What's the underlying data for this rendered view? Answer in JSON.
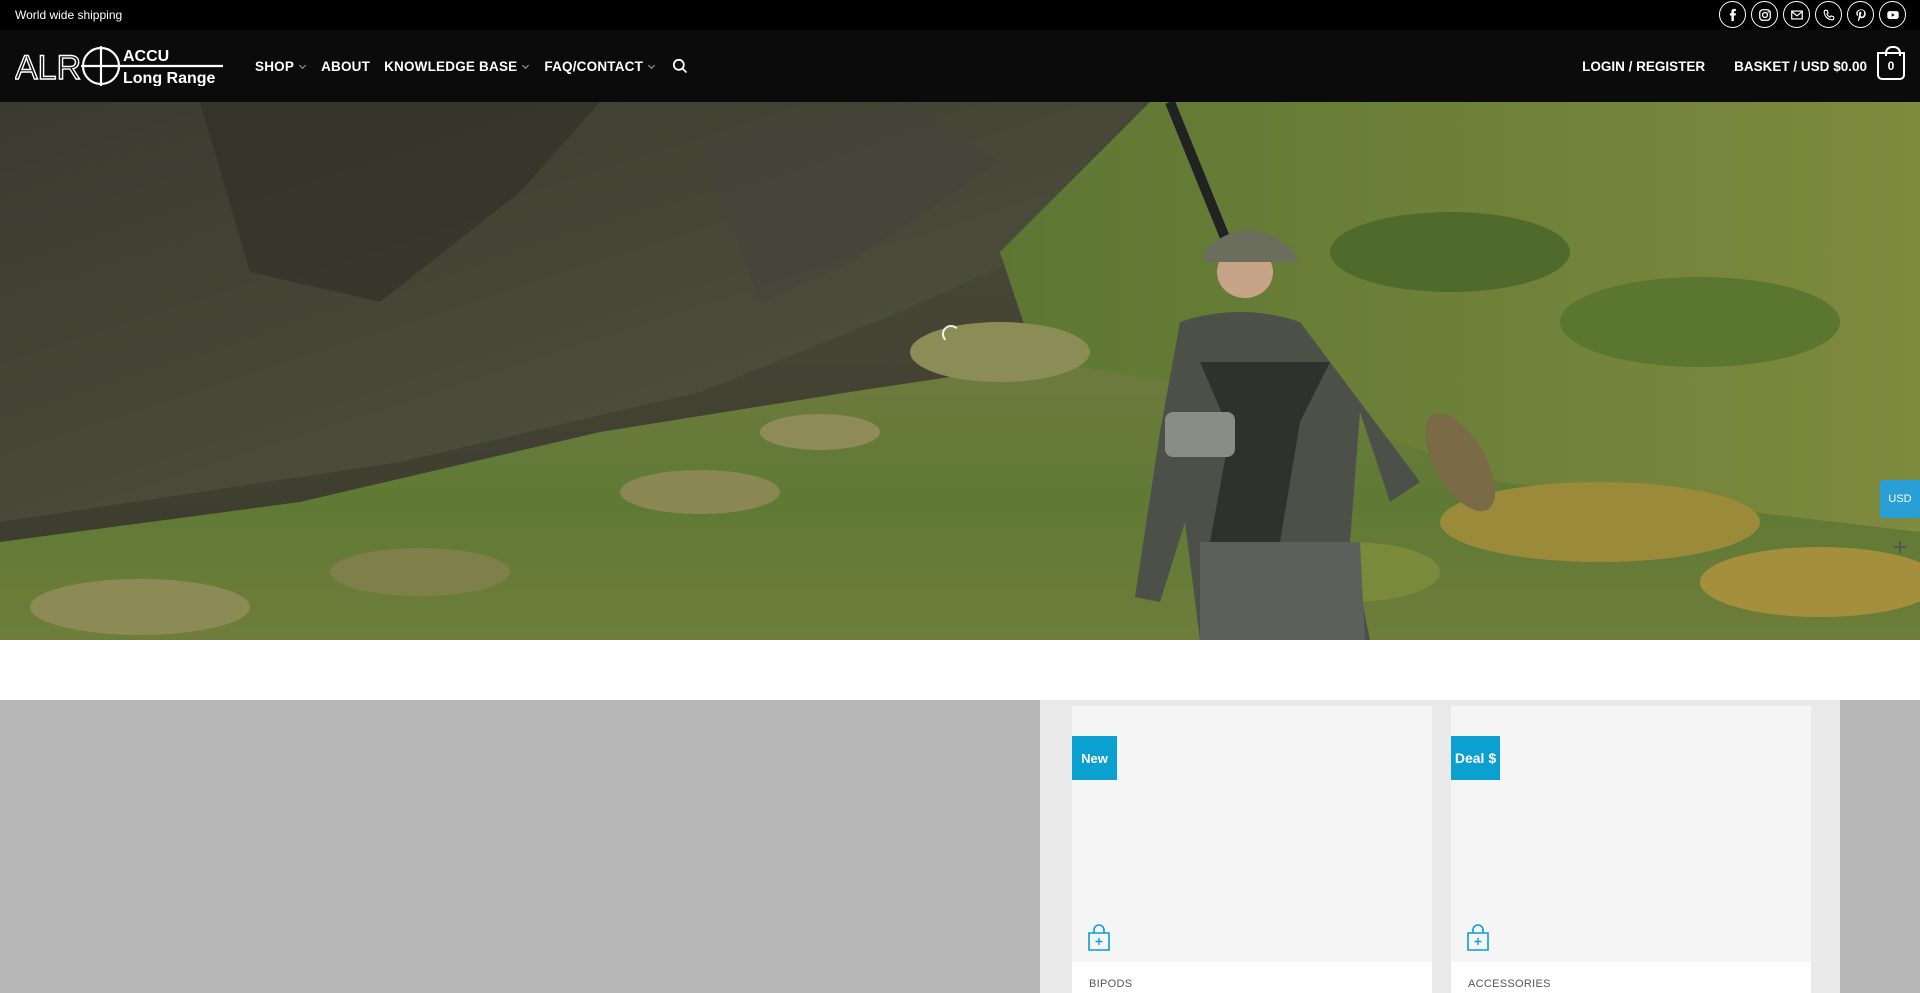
{
  "topbar": {
    "message": "World wide shipping",
    "social_icons": [
      "facebook-icon",
      "instagram-icon",
      "email-icon",
      "phone-icon",
      "pinterest-icon",
      "youtube-icon"
    ]
  },
  "header": {
    "logo": {
      "mark": "ALR",
      "line1": "ACCU",
      "line2": "Long Range"
    },
    "nav": [
      {
        "label": "SHOP",
        "has_dropdown": true
      },
      {
        "label": "ABOUT",
        "has_dropdown": false
      },
      {
        "label": "KNOWLEDGE BASE",
        "has_dropdown": true
      },
      {
        "label": "FAQ/CONTACT",
        "has_dropdown": true
      }
    ],
    "login_label": "LOGIN / REGISTER",
    "basket_label": "BASKET / USD",
    "basket_amount": "$0.00",
    "cart_count": "0"
  },
  "currency_widget": {
    "label": "USD"
  },
  "products": [
    {
      "badge": "New",
      "category": "BIPODS"
    },
    {
      "badge": "Deal $",
      "category": "ACCESSORIES"
    }
  ],
  "colors": {
    "topbar_bg": "#000000",
    "header_bg": "#0b0b0b",
    "accent": "#0aa0cf",
    "currency_bg": "#2a9fd6",
    "lower_bg": "#b7b7b7"
  }
}
